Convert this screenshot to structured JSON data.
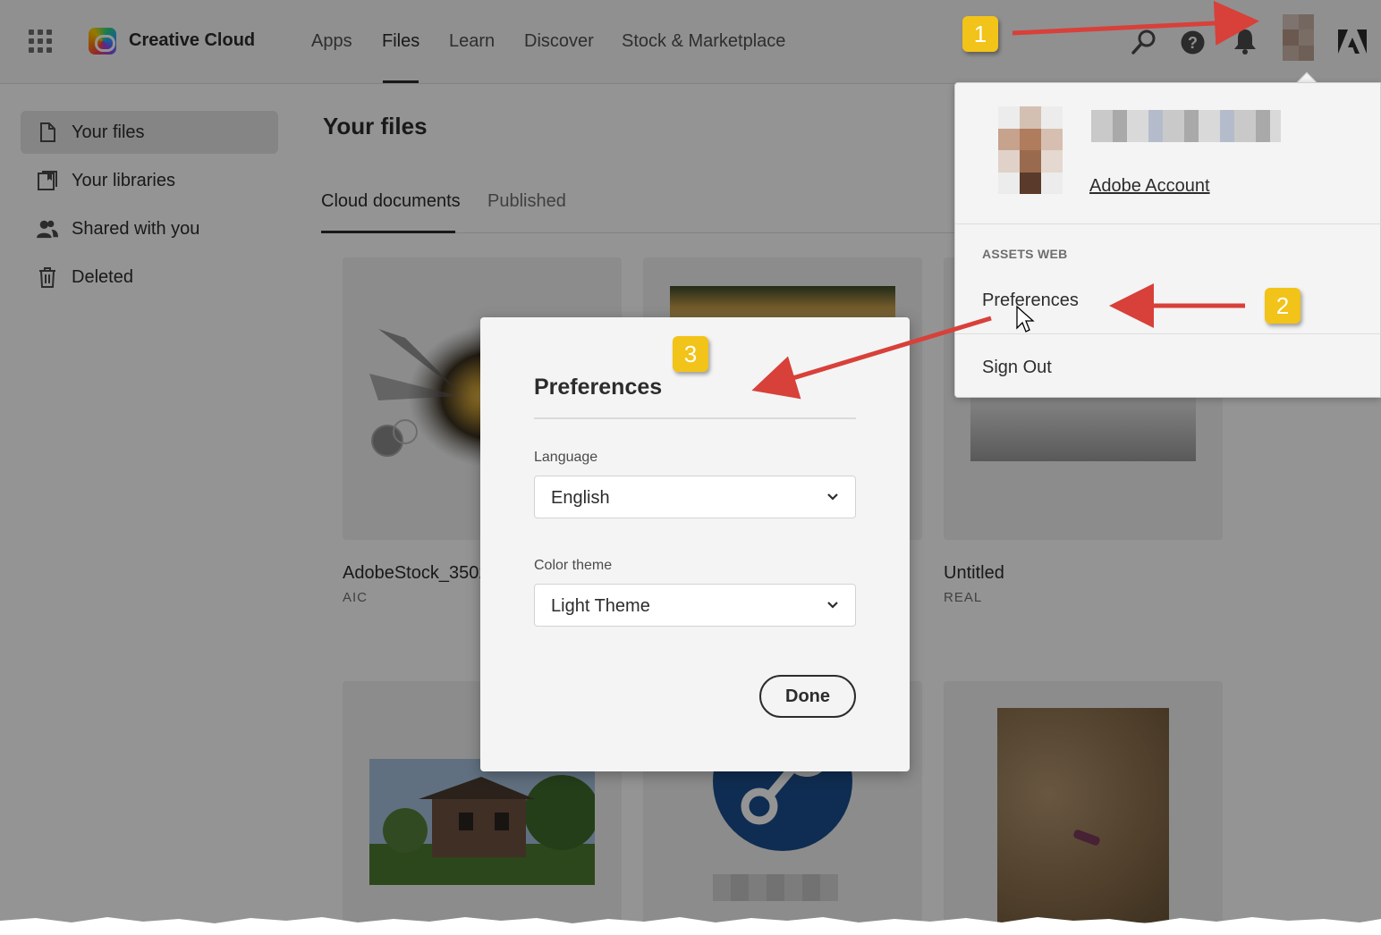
{
  "app": {
    "brand": "Creative Cloud"
  },
  "nav": [
    {
      "label": "Apps",
      "active": false
    },
    {
      "label": "Files",
      "active": true
    },
    {
      "label": "Learn",
      "active": false
    },
    {
      "label": "Discover",
      "active": false
    },
    {
      "label": "Stock & Marketplace",
      "active": false
    }
  ],
  "header_icons": [
    "search-icon",
    "help-icon",
    "notifications-bell-icon",
    "avatar",
    "adobe-logo-icon"
  ],
  "sidebar": {
    "items": [
      {
        "label": "Your files",
        "icon": "document-icon",
        "selected": true
      },
      {
        "label": "Your libraries",
        "icon": "libraries-icon",
        "selected": false
      },
      {
        "label": "Shared with you",
        "icon": "people-icon",
        "selected": false
      },
      {
        "label": "Deleted",
        "icon": "trash-icon",
        "selected": false
      }
    ]
  },
  "main": {
    "title": "Your files",
    "tabs": [
      {
        "label": "Cloud documents",
        "active": true
      },
      {
        "label": "Published",
        "active": false
      }
    ],
    "cards": [
      {
        "title": "AdobeStock_3502",
        "type": "AIC"
      },
      {
        "title": "Untitled",
        "type": "REAL"
      }
    ]
  },
  "account_menu": {
    "account_link": "Adobe Account",
    "section_label": "ASSETS WEB",
    "items": [
      "Preferences",
      "Sign Out"
    ]
  },
  "preferences_dialog": {
    "title": "Preferences",
    "language_label": "Language",
    "language_value": "English",
    "theme_label": "Color theme",
    "theme_value": "Light Theme",
    "done_label": "Done"
  },
  "annotations": {
    "badges": [
      "1",
      "2",
      "3"
    ],
    "color": "#d8403a",
    "badge_color": "#f2c318"
  }
}
